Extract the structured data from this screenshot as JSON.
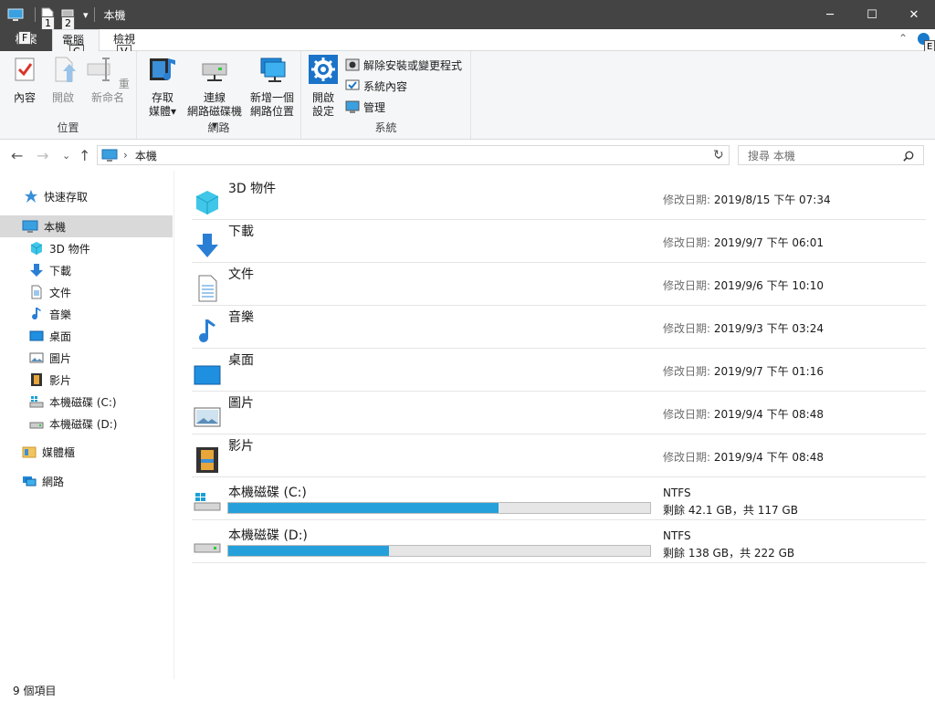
{
  "window": {
    "title": "本機",
    "minimize": "─",
    "maximize": "☐",
    "close": "✕"
  },
  "quick_access": {
    "keytips": [
      "1",
      "2"
    ],
    "dropdown": "▾"
  },
  "ribbon_tabs": [
    {
      "label": "檔案",
      "keytip": "F"
    },
    {
      "label": "電腦",
      "keytip": "C"
    },
    {
      "label": "檢視",
      "keytip": "V"
    }
  ],
  "ribbon_right": {
    "collapse": "⌃",
    "help_keytip": "E"
  },
  "ribbon": {
    "location": {
      "label": "位置",
      "buttons": [
        "內容",
        "開啟",
        "重新命名"
      ]
    },
    "network": {
      "label": "網路",
      "buttons": [
        {
          "line1": "存取",
          "line2": "媒體"
        },
        {
          "line1": "連線",
          "line2": "網路磁碟機"
        },
        {
          "line1": "新增一個",
          "line2": "網路位置"
        }
      ]
    },
    "system": {
      "label": "系統",
      "open_settings": {
        "line1": "開啟",
        "line2": "設定"
      },
      "small": [
        "解除安裝或變更程式",
        "系統內容",
        "管理"
      ]
    }
  },
  "address": {
    "path": "本機",
    "sep": "›",
    "dropdown": "⌄",
    "refresh": "↻",
    "search_placeholder": "搜尋 本機",
    "back": "←",
    "forward": "→",
    "recent": "⌄",
    "up": "↑"
  },
  "nav": {
    "quick_access": "快速存取",
    "this_pc": "本機",
    "children": [
      "3D 物件",
      "下載",
      "文件",
      "音樂",
      "桌面",
      "圖片",
      "影片",
      "本機磁碟 (C:)",
      "本機磁碟 (D:)"
    ],
    "libraries": "媒體櫃",
    "network": "網路"
  },
  "folders": [
    {
      "name": "3D 物件",
      "label": "修改日期:",
      "date": "2019/8/15 下午 07:34"
    },
    {
      "name": "下載",
      "label": "修改日期:",
      "date": "2019/9/7 下午 06:01"
    },
    {
      "name": "文件",
      "label": "修改日期:",
      "date": "2019/9/6 下午 10:10"
    },
    {
      "name": "音樂",
      "label": "修改日期:",
      "date": "2019/9/3 下午 03:24"
    },
    {
      "name": "桌面",
      "label": "修改日期:",
      "date": "2019/9/7 下午 01:16"
    },
    {
      "name": "圖片",
      "label": "修改日期:",
      "date": "2019/9/4 下午 08:48"
    },
    {
      "name": "影片",
      "label": "修改日期:",
      "date": "2019/9/4 下午 08:48"
    }
  ],
  "drives": [
    {
      "name": "本機磁碟 (C:)",
      "fs": "NTFS",
      "free": "剩餘 42.1 GB，共 117 GB",
      "used_fraction": 0.64
    },
    {
      "name": "本機磁碟 (D:)",
      "fs": "NTFS",
      "free": "剩餘 138 GB，共 222 GB",
      "used_fraction": 0.38
    }
  ],
  "status": {
    "count": "9 個項目"
  },
  "colors": {
    "titlebar": "#444444",
    "accent": "#26a0da",
    "selected": "#d9d9d9"
  }
}
